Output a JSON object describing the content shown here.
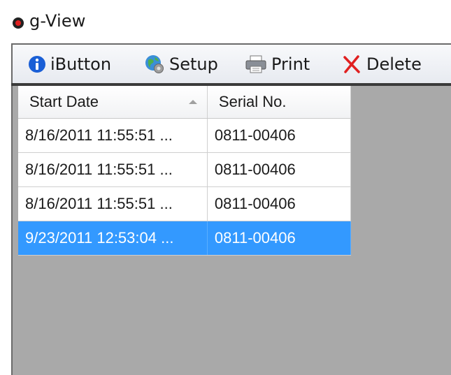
{
  "window": {
    "title": "g-View"
  },
  "toolbar": {
    "buttons": [
      {
        "label": "iButton",
        "icon": "info-icon"
      },
      {
        "label": "Setup",
        "icon": "globe-gear-icon"
      },
      {
        "label": "Print",
        "icon": "printer-icon"
      },
      {
        "label": "Delete",
        "icon": "red-x-icon"
      }
    ]
  },
  "grid": {
    "columns": [
      "Start Date",
      "Serial No."
    ],
    "sort": {
      "column": "Start Date",
      "direction": "ascending"
    },
    "rows": [
      {
        "start_date": "8/16/2011 11:55:51 ...",
        "serial": "0811-00406",
        "selected": false
      },
      {
        "start_date": "8/16/2011 11:55:51 ...",
        "serial": "0811-00406",
        "selected": false
      },
      {
        "start_date": "8/16/2011 11:55:51 ...",
        "serial": "0811-00406",
        "selected": false
      },
      {
        "start_date": "9/23/2011 12:53:04 ...",
        "serial": "0811-00406",
        "selected": true
      }
    ]
  },
  "colors": {
    "selection": "#3399ff",
    "empty_area": "#a9a9a9",
    "delete_x": "#e02020",
    "info_blue": "#1a5fd6"
  }
}
